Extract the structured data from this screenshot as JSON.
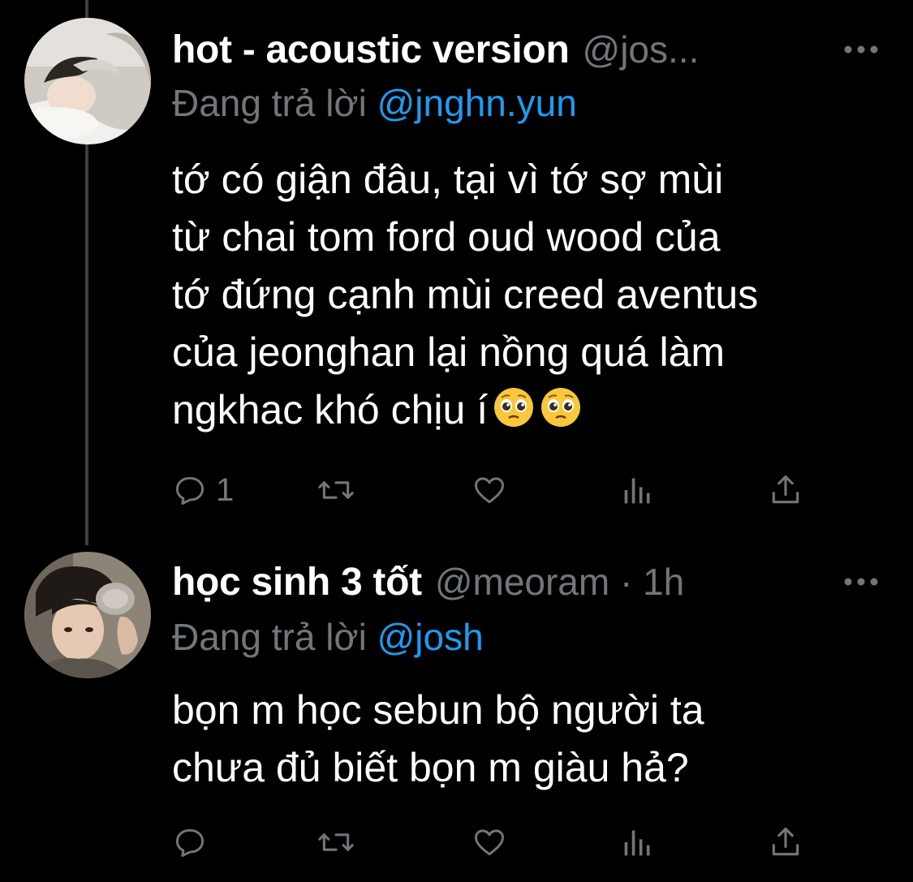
{
  "colors": {
    "background": "#000000",
    "primary_text": "#ffffff",
    "secondary_text": "#71767b",
    "mention": "#1d9bf0",
    "thread_line": "#3a3d41"
  },
  "tweets": [
    {
      "display_name": "hot - acoustic version",
      "handle": "@jos...",
      "reply_prefix": "Đang trả lời ",
      "reply_to": "@jnghn.yun",
      "text": "tớ có giận đâu, tại vì tớ sợ mùi\ntừ chai tom ford oud wood của\ntớ đứng cạnh mùi creed aventus\ncủa jeonghan lại nồng quá làm\nngkhac khó chịu í",
      "emojis": [
        "pleading-face",
        "pleading-face"
      ],
      "reply_count": "1",
      "avatar": "profile-photo-person-lying-on-pillow"
    },
    {
      "display_name": "học sinh 3 tốt",
      "handle": "@meoram · 1h",
      "reply_prefix": "Đang trả lời ",
      "reply_to": "@josh",
      "text": "bọn m học sebun bộ người ta\nchưa đủ biết bọn m giàu hả?",
      "reply_count": "",
      "avatar": "profile-photo-person-holding-stone"
    }
  ],
  "icons": {
    "reply": "speech-bubble-icon",
    "retweet": "retweet-arrows-icon",
    "like": "heart-icon",
    "views": "bar-chart-icon",
    "share": "share-upload-icon",
    "more": "more-dots-icon"
  }
}
